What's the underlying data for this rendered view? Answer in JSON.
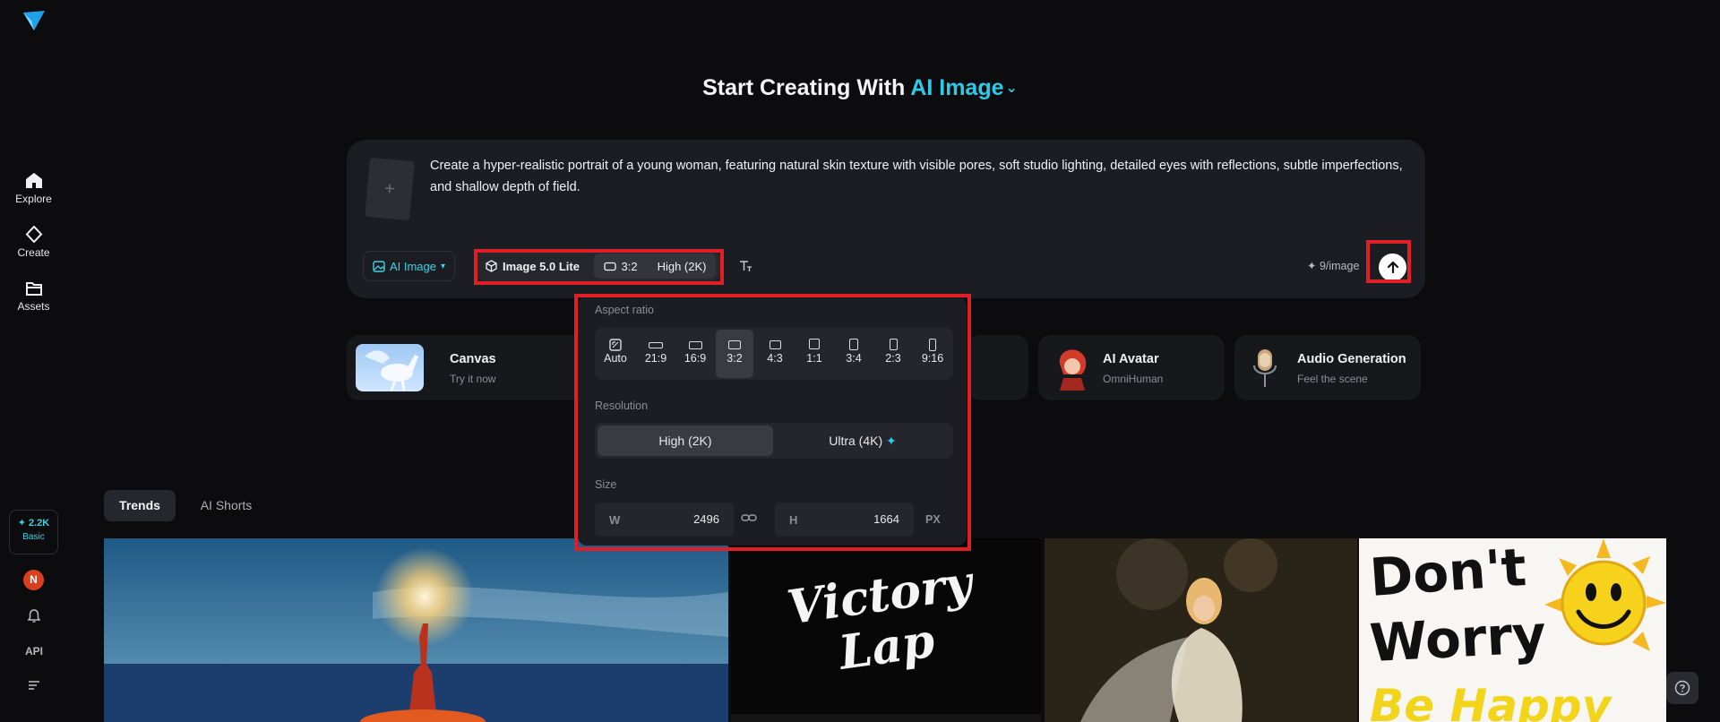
{
  "sidebar": {
    "items": [
      {
        "label": "Explore",
        "icon": "home-icon"
      },
      {
        "label": "Create",
        "icon": "diamond-icon"
      },
      {
        "label": "Assets",
        "icon": "folder-icon"
      }
    ],
    "credits": "✦ 2.2K",
    "plan": "Basic",
    "avatar_initial": "N",
    "api_label": "API"
  },
  "heading": {
    "prefix": "Start Creating With",
    "accent": "AI Image"
  },
  "prompt": {
    "text": "Create a hyper-realistic portrait of a young woman, featuring natural skin texture with visible pores, soft studio lighting, detailed eyes with reflections, subtle imperfections, and shallow depth of field.",
    "upload_symbol": "+"
  },
  "toolbar": {
    "mode_label": "AI Image",
    "model_label": "Image 5.0 Lite",
    "ratio_label": "3:2",
    "quality_label": "High (2K)",
    "cost_label": "✦ 9/image"
  },
  "cards": [
    {
      "title": "Canvas",
      "sub": "Try it now"
    },
    {
      "title": "AI Avatar",
      "sub": "OmniHuman"
    },
    {
      "title": "Audio Generation",
      "sub": "Feel the scene"
    }
  ],
  "popup": {
    "aspect_title": "Aspect ratio",
    "ratios": [
      "Auto",
      "21:9",
      "16:9",
      "3:2",
      "4:3",
      "1:1",
      "3:4",
      "2:3",
      "9:16"
    ],
    "selected_ratio": "3:2",
    "resolution_title": "Resolution",
    "res_options": [
      "High (2K)",
      "Ultra (4K)"
    ],
    "size_title": "Size",
    "width_key": "W",
    "width_value": "2496",
    "height_key": "H",
    "height_value": "1664",
    "unit": "PX"
  },
  "tabs": [
    "Trends",
    "AI Shorts"
  ],
  "gallery": {
    "victory_text": "Victory Lap",
    "worry_text_1": "Don't",
    "worry_text_2": "Worry",
    "worry_text_3": "Be Happy"
  },
  "colors": {
    "accent": "#30c9e6",
    "highlight": "#e01e26",
    "panel": "#1c1d22"
  }
}
